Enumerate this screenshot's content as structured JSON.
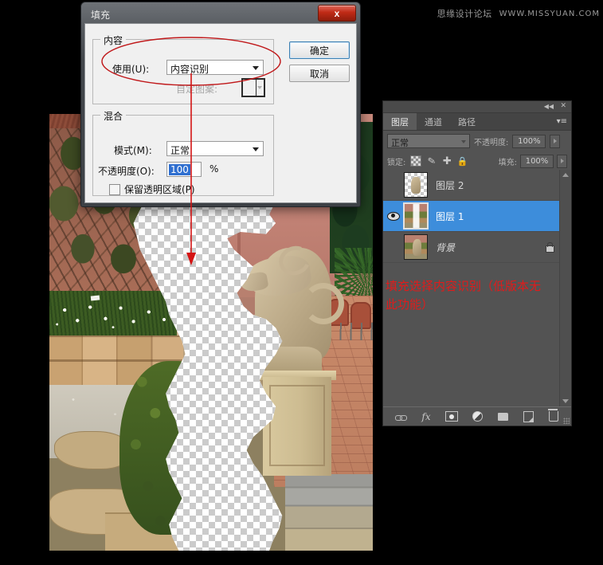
{
  "watermark": {
    "cn": "思缘设计论坛",
    "en": "WWW.MISSYUAN.COM"
  },
  "dialog": {
    "title": "填充",
    "close_label": "x",
    "content_group": {
      "legend": "内容",
      "use_label": "使用(U):",
      "use_value": "内容识别",
      "pattern_label": "自定图案:"
    },
    "blend_group": {
      "legend": "混合",
      "mode_label": "模式(M):",
      "mode_value": "正常",
      "opacity_label": "不透明度(O):",
      "opacity_value": "100",
      "opacity_unit": "%",
      "preserve_label": "保留透明区域(P)"
    },
    "ok_label": "确定",
    "cancel_label": "取消"
  },
  "layers_panel": {
    "collapse_icon": "◀◀",
    "close_icon": "✕",
    "menu_icon": "▾≡",
    "tabs": [
      {
        "label": "图层",
        "active": true
      },
      {
        "label": "通道",
        "active": false
      },
      {
        "label": "路径",
        "active": false
      }
    ],
    "blend_mode": "正常",
    "opacity_label": "不透明度:",
    "opacity_value": "100%",
    "lock_label": "锁定:",
    "lock_icons": [
      "transparency-lock-icon",
      "brush-lock-icon",
      "move-lock-icon",
      "all-lock-icon"
    ],
    "fill_label": "填充:",
    "fill_value": "100%",
    "layers": [
      {
        "name": "图层 2",
        "visible": false,
        "selected": false,
        "locked": false,
        "thumb": "transparent"
      },
      {
        "name": "图层 1",
        "visible": true,
        "selected": true,
        "locked": false,
        "thumb": "half"
      },
      {
        "name": "背景",
        "visible": false,
        "selected": false,
        "locked": true,
        "thumb": "photo"
      }
    ],
    "footer_icons": [
      "link-layers-icon",
      "layer-style-fx-icon",
      "add-mask-icon",
      "adjustment-layer-icon",
      "new-group-icon",
      "new-layer-icon",
      "delete-layer-icon"
    ]
  },
  "annotation": {
    "red_note": "填充选择内容识别（低版本无\n此功能）",
    "red_color": "#e01b1b"
  }
}
